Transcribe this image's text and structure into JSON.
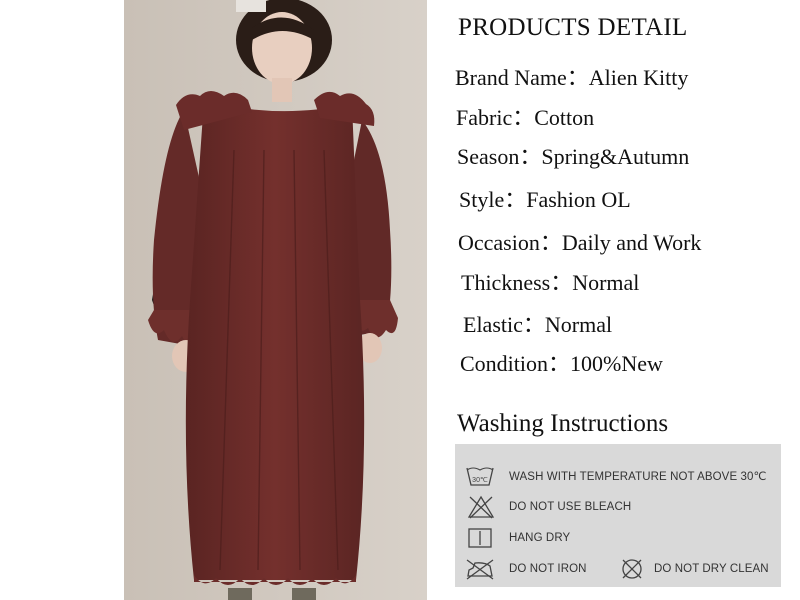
{
  "product_detail": {
    "title": "PRODUCTS DETAIL",
    "specs": [
      {
        "key": "Brand Name：",
        "value": "Alien Kitty"
      },
      {
        "key": "Fabric：",
        "value": "Cotton"
      },
      {
        "key": "Season：",
        "value": "Spring&Autumn"
      },
      {
        "key": "Style：",
        "value": "Fashion OL"
      },
      {
        "key": "Occasion：",
        "value": "Daily and Work"
      },
      {
        "key": "Thickness：",
        "value": "Normal"
      },
      {
        "key": "Elastic：",
        "value": "Normal"
      },
      {
        "key": "Condition：",
        "value": "100%New"
      }
    ]
  },
  "washing": {
    "heading": "Washing Instructions",
    "items": [
      {
        "icon": "wash-30-icon",
        "icon_text": "30℃",
        "text": "WASH WITH TEMPERATURE NOT ABOVE 30℃"
      },
      {
        "icon": "no-bleach-icon",
        "text": "DO NOT USE BLEACH"
      },
      {
        "icon": "hang-dry-icon",
        "text": "HANG DRY"
      },
      {
        "icon": "no-iron-icon",
        "text": "DO NOT IRON"
      },
      {
        "icon": "no-dry-clean-icon",
        "text": "DO NOT DRY CLEAN"
      }
    ]
  },
  "colors": {
    "dress": "#6b2c2a",
    "background_photo": "#cfc6bd",
    "panel": "#d9d9d9"
  }
}
